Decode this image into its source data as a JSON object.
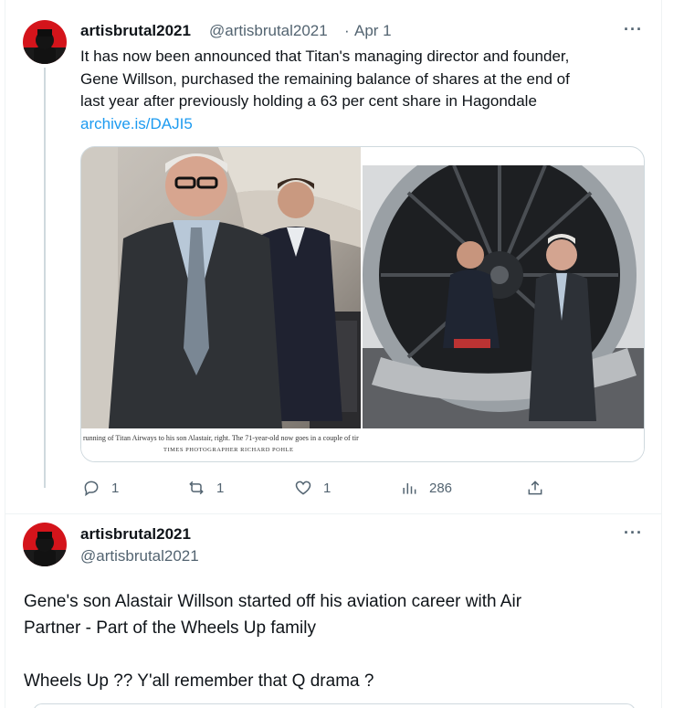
{
  "tweet1": {
    "username": "artisbrutal2021",
    "handle": "@artisbrutal2021",
    "separator": "·",
    "date": "Apr 1",
    "more": "···",
    "text_lines": [
      "It has now been announced that Titan's managing director and founder,",
      "Gene Willson, purchased the remaining balance of shares at the end of",
      "last year after previously holding a 63 per cent share in Hagondale"
    ],
    "link": "archive.is/DAJI5",
    "media": {
      "caption": "running of Titan Airways to his son Alastair, right. The 71-year-old now goes in a couple of tir",
      "credit": "TIMES PHOTOGRAPHER RICHARD POHLE"
    },
    "actions": {
      "reply_count": "1",
      "retweet_count": "1",
      "like_count": "1",
      "views_count": "286"
    }
  },
  "tweet2": {
    "username": "artisbrutal2021",
    "handle": "@artisbrutal2021",
    "more": "···",
    "paragraphs": [
      "Gene's son Alastair Willson started off his aviation career with Air",
      "Partner - Part of the Wheels Up family",
      "Wheels Up ??  Y'all remember that Q drama ?"
    ]
  },
  "icons": {
    "reply": "reply-icon",
    "retweet": "retweet-icon",
    "like": "heart-icon",
    "views": "analytics-icon",
    "share": "share-icon"
  },
  "colors": {
    "link": "#1d9bf0",
    "text": "#0f1419",
    "secondary": "#536471",
    "border": "#cfd9de"
  }
}
